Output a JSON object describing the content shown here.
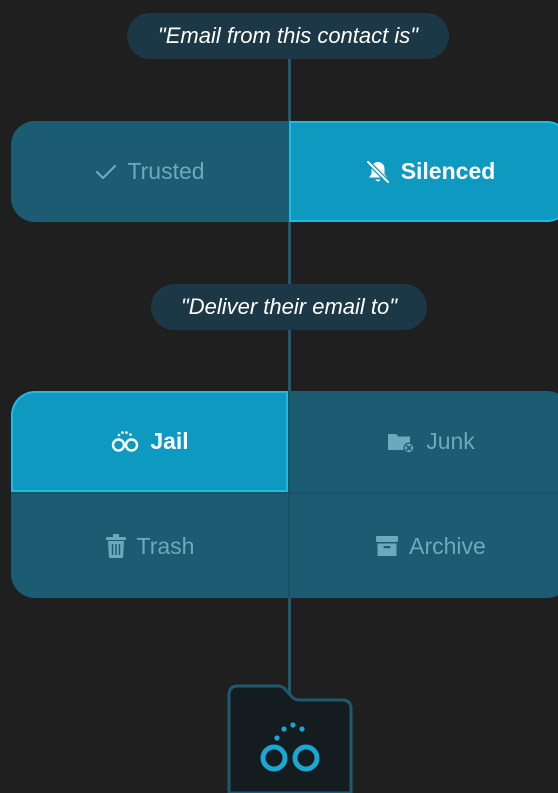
{
  "question_1": "\"Email from this contact is\"",
  "contact_status": {
    "trusted_label": "Trusted",
    "silenced_label": "Silenced",
    "selected": "Silenced"
  },
  "question_2": "\"Deliver their email to\"",
  "delivery": {
    "jail_label": "Jail",
    "junk_label": "Junk",
    "trash_label": "Trash",
    "archive_label": "Archive",
    "selected": "Jail"
  },
  "colors": {
    "background": "#1f1f1f",
    "group_bg": "#1b5c72",
    "selected_bg": "#0e99c1",
    "pill_bg": "#1c3846",
    "connector": "#1d5a6e",
    "icon_accent": "#1aa7d4"
  },
  "icons": {
    "trusted": "checkmark-icon",
    "silenced": "bell-slash-icon",
    "jail": "handcuffs-icon",
    "junk": "folder-x-icon",
    "trash": "trash-icon",
    "archive": "archive-box-icon",
    "destination": "jail-folder-icon"
  }
}
